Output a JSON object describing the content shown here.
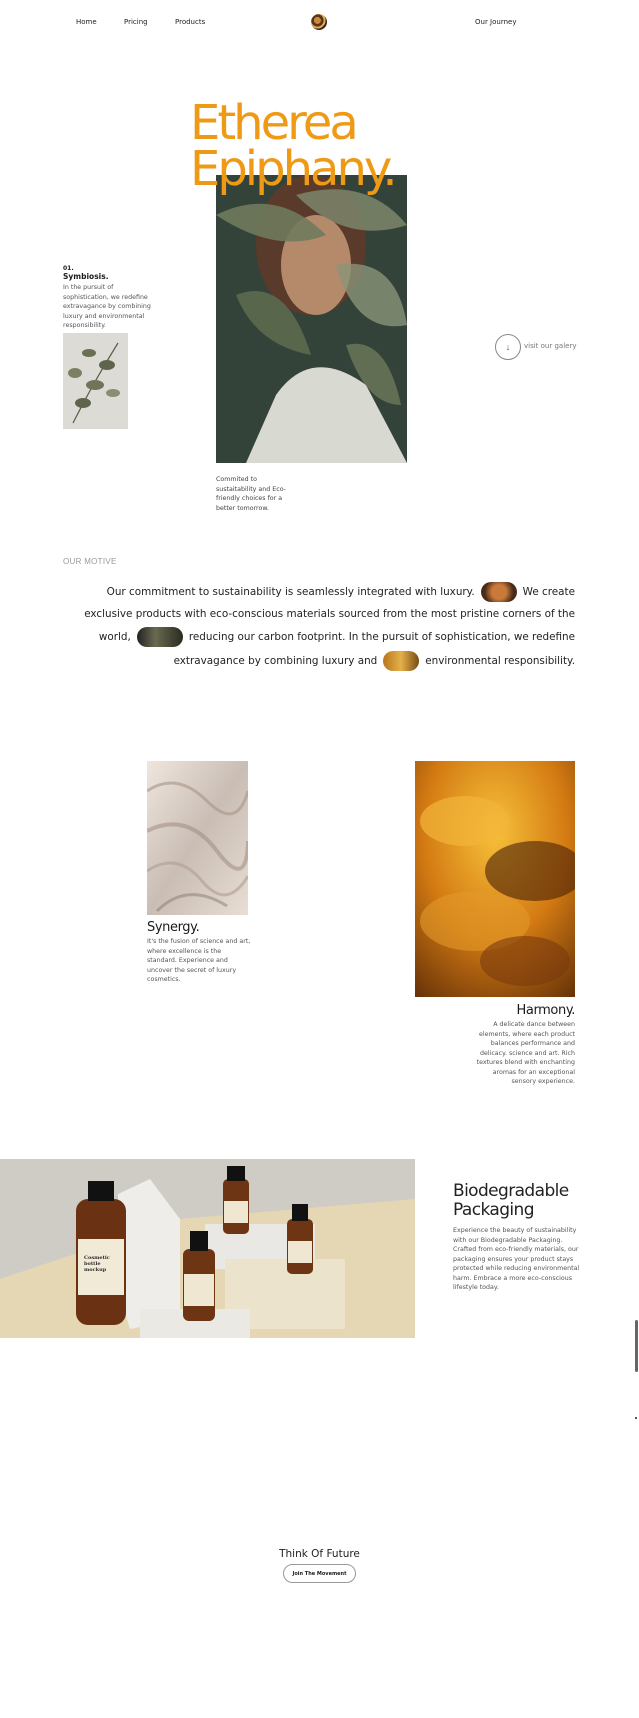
{
  "nav": {
    "home": "Home",
    "pricing": "Pricing",
    "products": "Products",
    "journey": "Our Journey",
    "logo_icon": "brand-logo"
  },
  "hero": {
    "title_line1": "Etherea",
    "title_line2": "Epiphany.",
    "accent_color": "#ef9a17",
    "number": "01.",
    "subtitle": "Symbiosis.",
    "description": "In the pursuit of sophistication, we redefine extravagance by combining luxury and environmental responsibility.",
    "caption": "Commited to sustaitability and Eco-friendly choices for a better tomorrow.",
    "gallery_label": "visit our galery",
    "gallery_icon": "arrow-down-icon"
  },
  "motive": {
    "label": "OUR MOTIVE",
    "line1_a": "Our commitment to sustainability is seamlessly integrated with luxury.",
    "line1_b": "We create",
    "line2": "exclusive products with eco-conscious materials sourced from the most pristine corners of the",
    "line3_a": "world,",
    "line3_b": "reducing our carbon footprint. In the pursuit of sophistication, we redefine",
    "line4_a": "extravagance by combining luxury and",
    "line4_b": "environmental responsibility."
  },
  "features": {
    "synergy_title": "Synergy.",
    "synergy_text": "It's the fusion of science and art, where excellence is the standard. Experience and uncover the secret of luxury cosmetics.",
    "harmony_title": "Harmony.",
    "harmony_text": "A delicate dance between elements, where each product balances performance and delicacy. science and art. Rich textures blend with enchanting aromas for an exceptional sensory experience."
  },
  "product": {
    "title_line1": "Biodegradable",
    "title_line2": "Packaging",
    "description": "Experience the beauty of sustainability with our Biodegradable Packaging. Crafted from eco-friendly materials, our packaging ensures your product stays protected while reducing environmental harm. Embrace a more eco-conscious lifestyle today.",
    "bottle_label": "Cosmetic bottle mockup"
  },
  "cta": {
    "title": "Think Of Future",
    "button": "Join The Movement"
  }
}
